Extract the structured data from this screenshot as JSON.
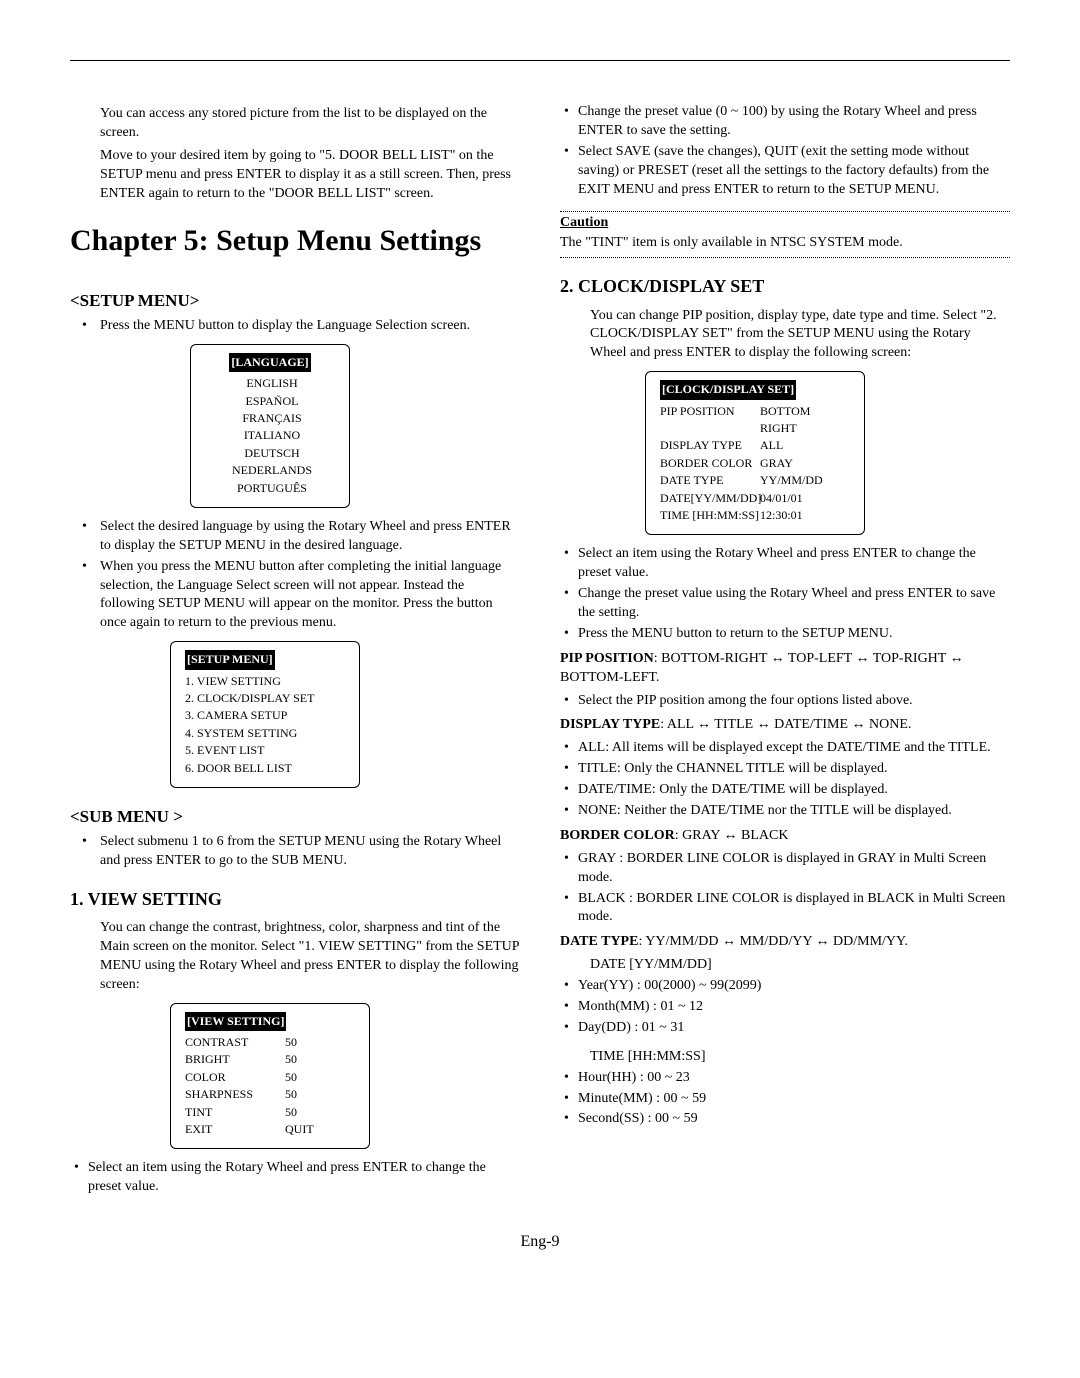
{
  "intro_para": [
    "You can access any stored picture from the list to be displayed on the screen.",
    "Move to your desired item by going to \"5. DOOR BELL LIST\" on the SETUP menu and press  ENTER to display it as a still screen. Then, press ENTER again to return to the \"DOOR BELL LIST\" screen."
  ],
  "chapter_title": "Chapter 5: Setup Menu Settings",
  "setup_menu": {
    "heading": "<SETUP MENU>",
    "b1": "Press the MENU button to display the Language Selection screen.",
    "lang_header": "[LANGUAGE]",
    "langs": [
      "ENGLISH",
      "ESPAÑOL",
      "FRANÇAIS",
      "ITALIANO",
      "DEUTSCH",
      "NEDERLANDS",
      "PORTUGUÊS"
    ],
    "b2": "Select the desired language by using the Rotary Wheel and press ENTER to display the SETUP MENU in the desired language.",
    "b3": "When you press the MENU button after completing the initial language selection, the Language Select screen will not appear. Instead the following SETUP MENU will appear on the monitor. Press the button once again to return to the previous menu.",
    "setup_header": "[SETUP MENU]",
    "setup_items": [
      "1. VIEW SETTING",
      "2. CLOCK/DISPLAY SET",
      "3. CAMERA SETUP",
      "4. SYSTEM SETTING",
      "5. EVENT LIST",
      "6. DOOR BELL LIST"
    ]
  },
  "sub_menu": {
    "heading": "<SUB MENU >",
    "b1": "Select submenu 1 to 6 from the SETUP MENU using the Rotary Wheel and press ENTER to go to the SUB MENU."
  },
  "view_setting": {
    "heading": "1. VIEW SETTING",
    "intro": "You can change the contrast, brightness, color, sharpness and tint of the Main screen on the monitor. Select \"1. VIEW SETTING\" from the SETUP MENU using the Rotary Wheel and press ENTER to display the following screen:",
    "box_header": "[VIEW SETTING]",
    "rows": [
      {
        "k": "CONTRAST",
        "v": "50"
      },
      {
        "k": "BRIGHT",
        "v": "50"
      },
      {
        "k": "COLOR",
        "v": "50"
      },
      {
        "k": "SHARPNESS",
        "v": "50"
      },
      {
        "k": "TINT",
        "v": "50"
      },
      {
        "k": "EXIT",
        "v": "QUIT"
      }
    ],
    "b1": "Select an item using the Rotary Wheel and press ENTER to change the preset value."
  },
  "right_top": {
    "b1": "Change the preset value (0 ~ 100) by using the Rotary Wheel and press ENTER to save the setting.",
    "b2": "Select SAVE (save the changes), QUIT (exit the setting mode without saving) or PRESET (reset all the settings to the factory defaults) from the EXIT MENU and press ENTER to return to the SETUP MENU."
  },
  "caution": {
    "title": "Caution",
    "text": "The \"TINT\" item is only available in NTSC SYSTEM mode."
  },
  "clock": {
    "heading": "2. CLOCK/DISPLAY SET",
    "intro": "You can change PIP position, display type, date type and time. Select \"2. CLOCK/DISPLAY SET\" from the SETUP MENU using the Rotary Wheel and press ENTER to display the following screen:",
    "box_header": "[CLOCK/DISPLAY SET]",
    "rows": [
      {
        "k": "PIP POSITION",
        "v": "BOTTOM RIGHT"
      },
      {
        "k": "DISPLAY TYPE",
        "v": "ALL"
      },
      {
        "k": "BORDER COLOR",
        "v": "GRAY"
      },
      {
        "k": "DATE TYPE",
        "v": "YY/MM/DD"
      },
      {
        "k": "DATE[YY/MM/DD]",
        "v": "04/01/01"
      },
      {
        "k": "TIME [HH:MM:SS]",
        "v": "12:30:01"
      }
    ],
    "b1": "Select an item using the Rotary Wheel and press ENTER to change the preset value.",
    "b2": "Change the preset value using the Rotary Wheel and press ENTER to save the setting.",
    "b3": "Press the MENU button to return to the SETUP MENU.",
    "pip_label": "PIP POSITION",
    "pip_text": ": BOTTOM-RIGHT ↔ TOP-LEFT ↔ TOP-RIGHT ↔ BOTTOM-LEFT.",
    "pip_b1": "Select the PIP position among the four options listed above.",
    "disp_label": "DISPLAY TYPE",
    "disp_text": ": ALL ↔ TITLE ↔ DATE/TIME ↔ NONE.",
    "disp_b1": "ALL: All items will be displayed except the DATE/TIME and the TITLE.",
    "disp_b2": "TITLE: Only the CHANNEL TITLE will be displayed.",
    "disp_b3": "DATE/TIME: Only the DATE/TIME will be displayed.",
    "disp_b4": "NONE: Neither the DATE/TIME nor the TITLE will be displayed.",
    "border_label": "BORDER COLOR",
    "border_text": ": GRAY ↔ BLACK",
    "border_b1": "GRAY : BORDER LINE COLOR is displayed in GRAY in Multi Screen mode.",
    "border_b2": "BLACK : BORDER LINE COLOR is displayed in BLACK in Multi Screen mode.",
    "date_label": "DATE TYPE",
    "date_text": ": YY/MM/DD ↔ MM/DD/YY ↔ DD/MM/YY.",
    "date_sub": "DATE [YY/MM/DD]",
    "date_b1": "Year(YY) : 00(2000) ~ 99(2099)",
    "date_b2": "Month(MM) : 01 ~ 12",
    "date_b3": "Day(DD) : 01 ~ 31",
    "time_sub": "TIME [HH:MM:SS]",
    "time_b1": "Hour(HH) : 00 ~ 23",
    "time_b2": "Minute(MM) : 00 ~ 59",
    "time_b3": "Second(SS) : 00 ~ 59"
  },
  "page_number": "Eng-9"
}
